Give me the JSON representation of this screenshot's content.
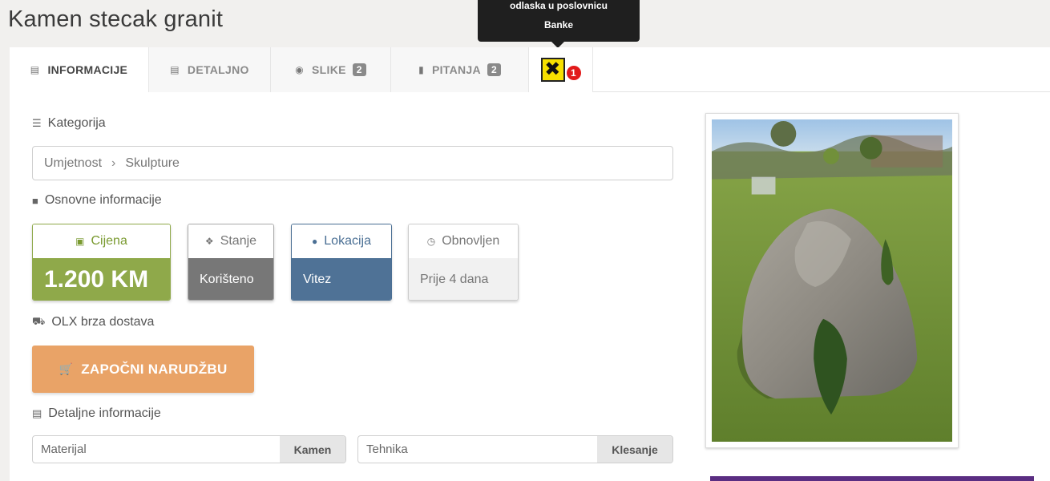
{
  "page": {
    "title": "Kamen stecak granit"
  },
  "tooltip": {
    "line1": "odlaska u poslovnicu",
    "line2": "Banke"
  },
  "tabs": [
    {
      "label": "INFORMACIJE",
      "icon": "id-card-icon"
    },
    {
      "label": "DETALJNO",
      "icon": "document-icon"
    },
    {
      "label": "SLIKE",
      "icon": "camera-icon",
      "badge": "2"
    },
    {
      "label": "PITANJA",
      "icon": "chat-icon",
      "badge": "2"
    }
  ],
  "bank_tab": {
    "count": "1",
    "logo_color": "#f7e000"
  },
  "category": {
    "label": "Kategorija",
    "path": [
      "Umjetnost",
      "Skulpture"
    ],
    "separator": "›"
  },
  "basic_info": {
    "label": "Osnovne informacije",
    "price": {
      "label": "Cijena",
      "value": "1.200 KM",
      "color": "#8fa94a"
    },
    "condition": {
      "label": "Stanje",
      "value": "Korišteno",
      "color": "#777777"
    },
    "location": {
      "label": "Lokacija",
      "value": "Vitez",
      "color": "#4f7296"
    },
    "updated": {
      "label": "Obnovljen",
      "value": "Prije 4 dana"
    }
  },
  "delivery": {
    "label": "OLX brza dostava",
    "button_label": "ZAPOČNI NARUDŽBU",
    "button_color": "#e9a367"
  },
  "detailed_info": {
    "label": "Detaljne informacije",
    "fields": [
      {
        "key": "Materijal",
        "value": "Kamen"
      },
      {
        "key": "Tehnika",
        "value": "Klesanje"
      }
    ]
  }
}
